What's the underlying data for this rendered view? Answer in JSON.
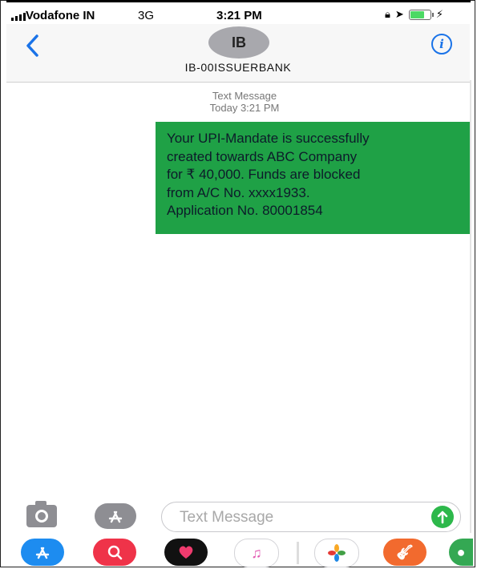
{
  "status_bar": {
    "carrier": "Vodafone IN",
    "network": "3G",
    "time": "3:21 PM",
    "battery_level": 0.75
  },
  "header": {
    "avatar_initials": "IB",
    "contact_name": "IB-00ISSUERBANK",
    "info_symbol": "i"
  },
  "conversation": {
    "meta_label": "Text Message",
    "meta_time": "Today 3:21 PM",
    "message_lines": [
      "Your UPI-Mandate is successfully",
      "created towards ABC Company",
      "for ₹ 40,000. Funds are blocked",
      "from A/C No. xxxx1933.",
      "Application No. 80001854"
    ],
    "bubble_color": "#1fa146"
  },
  "compose": {
    "placeholder": "Text Message"
  },
  "dock": {
    "apps": [
      "app-store-icon",
      "search-images-icon",
      "digital-touch-icon",
      "music-icon",
      "photos-icon",
      "garageband-icon",
      "maps-icon"
    ]
  },
  "colors": {
    "accent": "#1a73e8",
    "send": "#2db84b"
  }
}
